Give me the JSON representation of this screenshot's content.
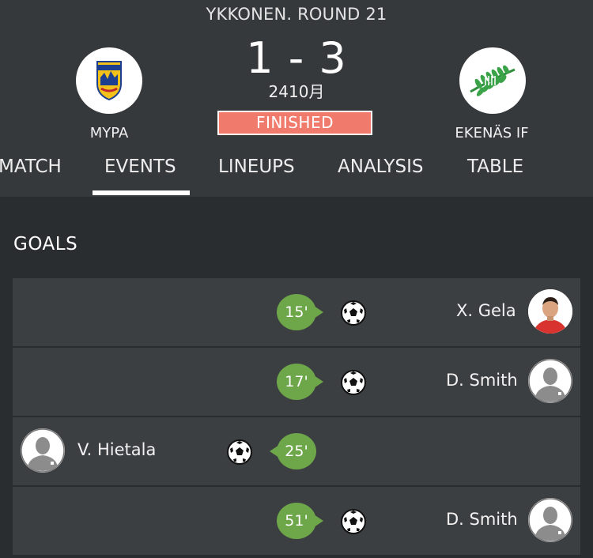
{
  "match": {
    "round_title": "YKKONEN. ROUND 21",
    "score": "1 - 3",
    "date": "2410月",
    "status": "FINISHED",
    "status_color": "#f07a6c",
    "home_team": {
      "name": "MYPA",
      "crest_icon": "mypa-crest-icon"
    },
    "away_team": {
      "name": "EKENÄS IF",
      "crest_icon": "ekenas-crest-icon"
    }
  },
  "tabs": [
    {
      "label": "MATCH",
      "active": false
    },
    {
      "label": "EVENTS",
      "active": true
    },
    {
      "label": "LINEUPS",
      "active": false
    },
    {
      "label": "ANALYSIS",
      "active": false
    },
    {
      "label": "TABLE",
      "active": false
    }
  ],
  "goals": {
    "title": "GOALS",
    "accent_color": "#6ea64a",
    "items": [
      {
        "minute": "15'",
        "player": "X. Gela",
        "side": "away",
        "avatar": "player-photo"
      },
      {
        "minute": "17'",
        "player": "D. Smith",
        "side": "away",
        "avatar": "player-placeholder-icon"
      },
      {
        "minute": "25'",
        "player": "V. Hietala",
        "side": "home",
        "avatar": "player-placeholder-icon"
      },
      {
        "minute": "51'",
        "player": "D. Smith",
        "side": "away",
        "avatar": "player-placeholder-icon"
      }
    ]
  }
}
